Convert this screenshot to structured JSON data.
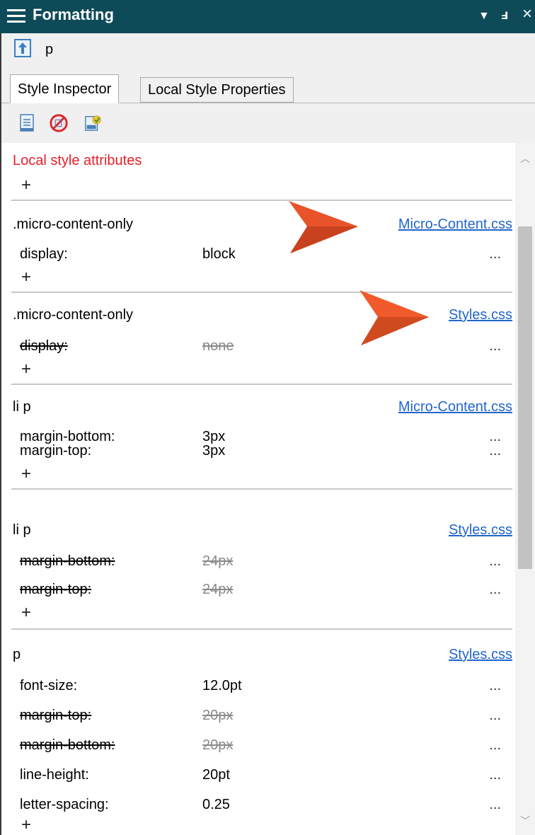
{
  "panel": {
    "title": "Formatting"
  },
  "titlebar": {
    "dropdown_glyph": "▼",
    "pin_glyph": "ⅎ",
    "close_glyph": "×"
  },
  "breadcrumb": {
    "element": "p"
  },
  "tabs": [
    {
      "label": "Style Inspector",
      "active": true
    },
    {
      "label": "Local Style Properties",
      "active": false
    }
  ],
  "local": {
    "label": "Local style attributes"
  },
  "plus": "+",
  "dots": "...",
  "rules": [
    {
      "selector": ".micro-content-only",
      "source": "Micro-Content.css",
      "props": [
        {
          "name": "display:",
          "value": "block",
          "overridden": false
        }
      ]
    },
    {
      "selector": ".micro-content-only",
      "source": "Styles.css",
      "props": [
        {
          "name": "display:",
          "value": "none",
          "overridden": true
        }
      ]
    },
    {
      "selector": "li p",
      "source": "Micro-Content.css",
      "props": [
        {
          "name": "margin-bottom:",
          "value": "3px",
          "overridden": false
        },
        {
          "name": "margin-top:",
          "value": "3px",
          "overridden": false
        }
      ]
    },
    {
      "selector": "li p",
      "source": "Styles.css",
      "props": [
        {
          "name": "margin-bottom:",
          "value": "24px",
          "overridden": true
        },
        {
          "name": "margin-top:",
          "value": "24px",
          "overridden": true
        }
      ]
    },
    {
      "selector": "p",
      "source": "Styles.css",
      "props": [
        {
          "name": "font-size:",
          "value": "12.0pt",
          "overridden": false
        },
        {
          "name": "margin-top:",
          "value": "20px",
          "overridden": true
        },
        {
          "name": "margin-bottom:",
          "value": "20px",
          "overridden": true
        },
        {
          "name": "line-height:",
          "value": "20pt",
          "overridden": false
        },
        {
          "name": "letter-spacing:",
          "value": "0.25",
          "overridden": false
        }
      ]
    }
  ],
  "colors": {
    "titlebar": "#0e4a57",
    "link": "#2266cc",
    "local_label": "#e8202a",
    "callout": "#e8532a"
  }
}
